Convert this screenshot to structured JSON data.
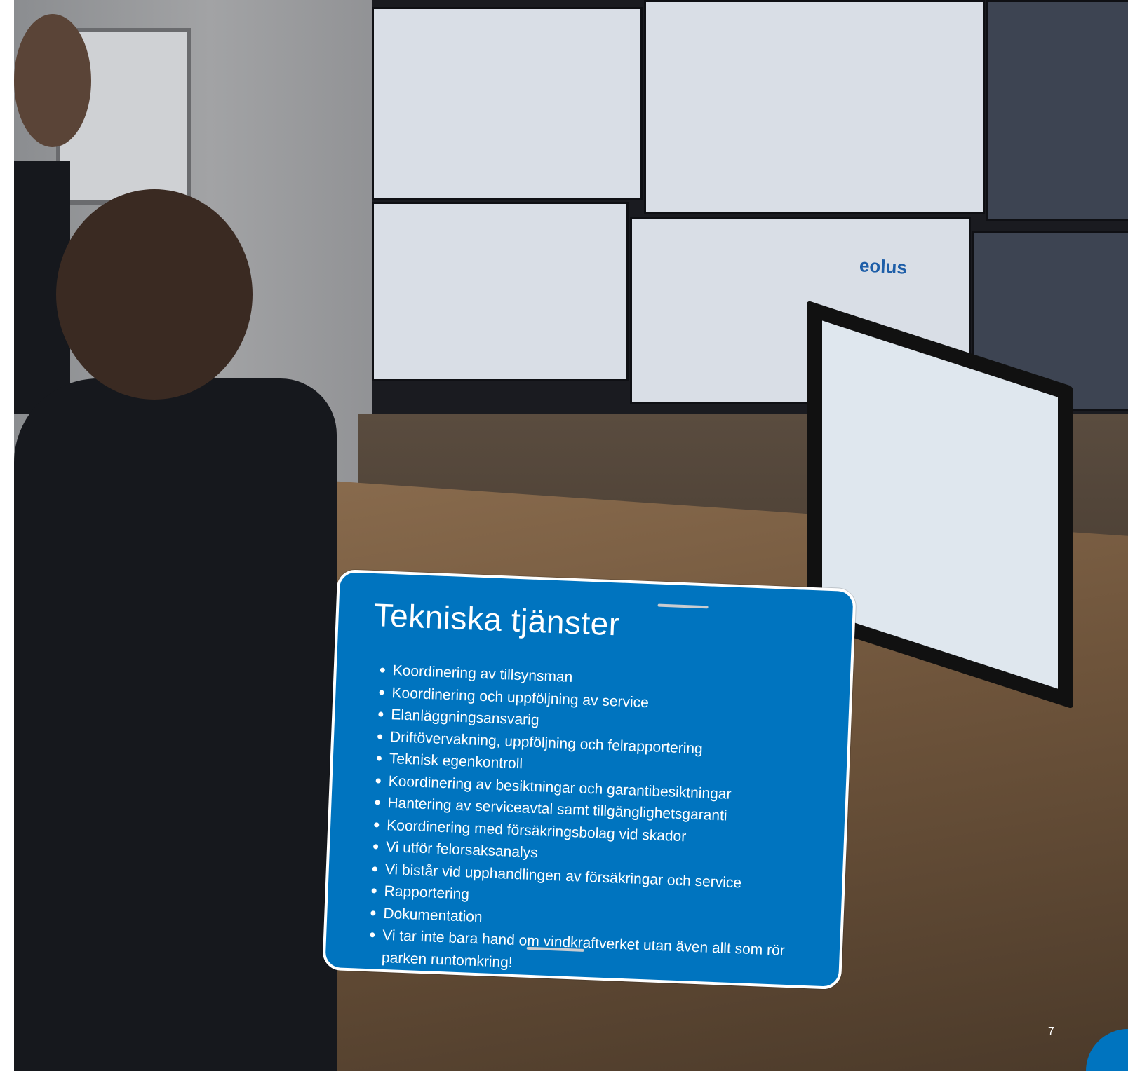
{
  "card": {
    "title": "Tekniska tjänster",
    "items": [
      "Koordinering av tillsynsman",
      "Koordinering och uppföljning av service",
      "Elanläggningsansvarig",
      "Driftövervakning, uppföljning och felrapportering",
      "Teknisk egenkontroll",
      "Koordinering av besiktningar och garantibesiktningar",
      "Hantering av serviceavtal samt tillgänglighetsgaranti",
      "Koordinering med försäkringsbolag vid skador",
      "Vi utför felorsaksanalys",
      "Vi bistår vid upphandlingen av försäkringar och service",
      "Rapportering",
      "Dokumentation",
      "Vi tar inte bara hand om vindkraftverket utan även allt som rör parken runtomkring!"
    ]
  },
  "photo": {
    "screen_logo": "eolus"
  },
  "page": {
    "number": "7"
  },
  "colors": {
    "accent": "#0074bf",
    "card_border": "#ffffff"
  }
}
